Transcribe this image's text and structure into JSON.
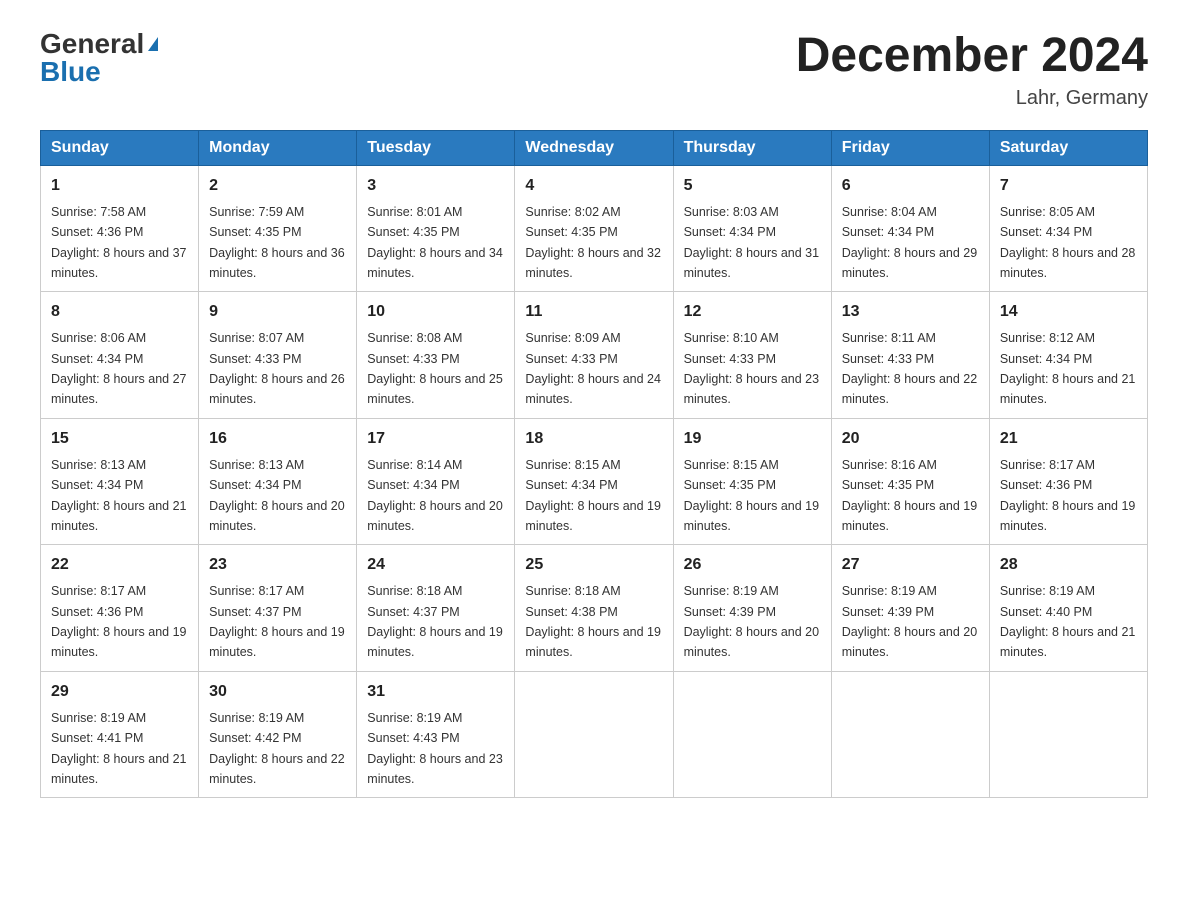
{
  "header": {
    "logo_general": "General",
    "logo_blue": "Blue",
    "month_title": "December 2024",
    "location": "Lahr, Germany"
  },
  "days_of_week": [
    "Sunday",
    "Monday",
    "Tuesday",
    "Wednesday",
    "Thursday",
    "Friday",
    "Saturday"
  ],
  "weeks": [
    [
      {
        "day": "1",
        "sunrise": "7:58 AM",
        "sunset": "4:36 PM",
        "daylight": "8 hours and 37 minutes."
      },
      {
        "day": "2",
        "sunrise": "7:59 AM",
        "sunset": "4:35 PM",
        "daylight": "8 hours and 36 minutes."
      },
      {
        "day": "3",
        "sunrise": "8:01 AM",
        "sunset": "4:35 PM",
        "daylight": "8 hours and 34 minutes."
      },
      {
        "day": "4",
        "sunrise": "8:02 AM",
        "sunset": "4:35 PM",
        "daylight": "8 hours and 32 minutes."
      },
      {
        "day": "5",
        "sunrise": "8:03 AM",
        "sunset": "4:34 PM",
        "daylight": "8 hours and 31 minutes."
      },
      {
        "day": "6",
        "sunrise": "8:04 AM",
        "sunset": "4:34 PM",
        "daylight": "8 hours and 29 minutes."
      },
      {
        "day": "7",
        "sunrise": "8:05 AM",
        "sunset": "4:34 PM",
        "daylight": "8 hours and 28 minutes."
      }
    ],
    [
      {
        "day": "8",
        "sunrise": "8:06 AM",
        "sunset": "4:34 PM",
        "daylight": "8 hours and 27 minutes."
      },
      {
        "day": "9",
        "sunrise": "8:07 AM",
        "sunset": "4:33 PM",
        "daylight": "8 hours and 26 minutes."
      },
      {
        "day": "10",
        "sunrise": "8:08 AM",
        "sunset": "4:33 PM",
        "daylight": "8 hours and 25 minutes."
      },
      {
        "day": "11",
        "sunrise": "8:09 AM",
        "sunset": "4:33 PM",
        "daylight": "8 hours and 24 minutes."
      },
      {
        "day": "12",
        "sunrise": "8:10 AM",
        "sunset": "4:33 PM",
        "daylight": "8 hours and 23 minutes."
      },
      {
        "day": "13",
        "sunrise": "8:11 AM",
        "sunset": "4:33 PM",
        "daylight": "8 hours and 22 minutes."
      },
      {
        "day": "14",
        "sunrise": "8:12 AM",
        "sunset": "4:34 PM",
        "daylight": "8 hours and 21 minutes."
      }
    ],
    [
      {
        "day": "15",
        "sunrise": "8:13 AM",
        "sunset": "4:34 PM",
        "daylight": "8 hours and 21 minutes."
      },
      {
        "day": "16",
        "sunrise": "8:13 AM",
        "sunset": "4:34 PM",
        "daylight": "8 hours and 20 minutes."
      },
      {
        "day": "17",
        "sunrise": "8:14 AM",
        "sunset": "4:34 PM",
        "daylight": "8 hours and 20 minutes."
      },
      {
        "day": "18",
        "sunrise": "8:15 AM",
        "sunset": "4:34 PM",
        "daylight": "8 hours and 19 minutes."
      },
      {
        "day": "19",
        "sunrise": "8:15 AM",
        "sunset": "4:35 PM",
        "daylight": "8 hours and 19 minutes."
      },
      {
        "day": "20",
        "sunrise": "8:16 AM",
        "sunset": "4:35 PM",
        "daylight": "8 hours and 19 minutes."
      },
      {
        "day": "21",
        "sunrise": "8:17 AM",
        "sunset": "4:36 PM",
        "daylight": "8 hours and 19 minutes."
      }
    ],
    [
      {
        "day": "22",
        "sunrise": "8:17 AM",
        "sunset": "4:36 PM",
        "daylight": "8 hours and 19 minutes."
      },
      {
        "day": "23",
        "sunrise": "8:17 AM",
        "sunset": "4:37 PM",
        "daylight": "8 hours and 19 minutes."
      },
      {
        "day": "24",
        "sunrise": "8:18 AM",
        "sunset": "4:37 PM",
        "daylight": "8 hours and 19 minutes."
      },
      {
        "day": "25",
        "sunrise": "8:18 AM",
        "sunset": "4:38 PM",
        "daylight": "8 hours and 19 minutes."
      },
      {
        "day": "26",
        "sunrise": "8:19 AM",
        "sunset": "4:39 PM",
        "daylight": "8 hours and 20 minutes."
      },
      {
        "day": "27",
        "sunrise": "8:19 AM",
        "sunset": "4:39 PM",
        "daylight": "8 hours and 20 minutes."
      },
      {
        "day": "28",
        "sunrise": "8:19 AM",
        "sunset": "4:40 PM",
        "daylight": "8 hours and 21 minutes."
      }
    ],
    [
      {
        "day": "29",
        "sunrise": "8:19 AM",
        "sunset": "4:41 PM",
        "daylight": "8 hours and 21 minutes."
      },
      {
        "day": "30",
        "sunrise": "8:19 AM",
        "sunset": "4:42 PM",
        "daylight": "8 hours and 22 minutes."
      },
      {
        "day": "31",
        "sunrise": "8:19 AM",
        "sunset": "4:43 PM",
        "daylight": "8 hours and 23 minutes."
      },
      null,
      null,
      null,
      null
    ]
  ]
}
